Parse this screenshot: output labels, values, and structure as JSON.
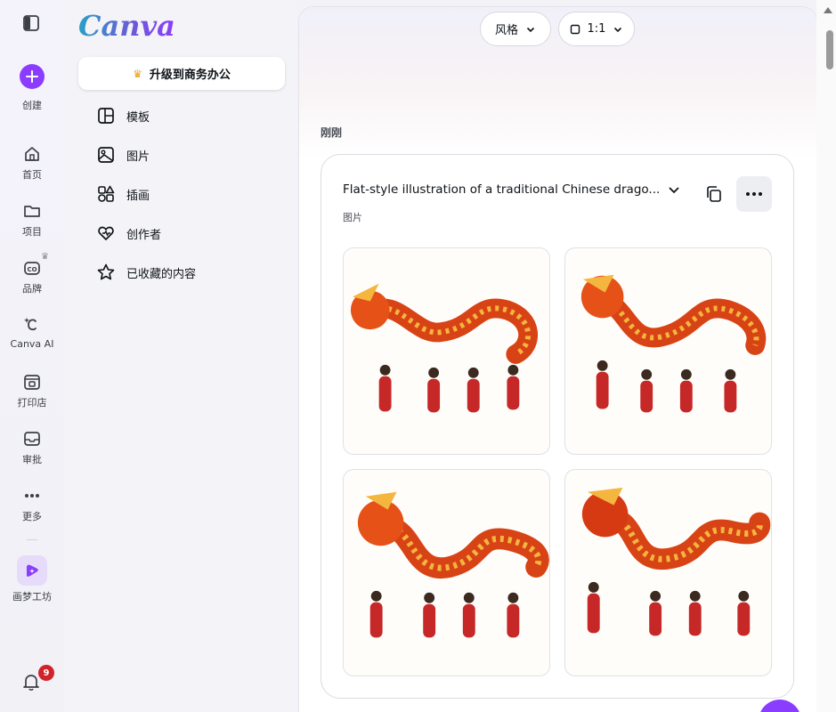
{
  "brand": {
    "logo_text": "Canva",
    "accent_color": "#8b3dff"
  },
  "rail": {
    "create_label": "创建",
    "items": [
      {
        "label": "首页",
        "icon": "home-icon"
      },
      {
        "label": "项目",
        "icon": "folder-icon"
      },
      {
        "label": "品牌",
        "icon": "brand-icon"
      },
      {
        "label": "Canva AI",
        "icon": "canva-ai-icon"
      },
      {
        "label": "打印店",
        "icon": "print-shop-icon"
      },
      {
        "label": "审批",
        "icon": "inbox-icon"
      },
      {
        "label": "更多",
        "icon": "more-dots-icon"
      },
      {
        "label": "画梦工坊",
        "icon": "dream-lab-icon"
      }
    ],
    "notification_count": "9"
  },
  "panel": {
    "upgrade_label": "升级到商务办公",
    "nav": [
      {
        "label": "模板",
        "icon": "template-icon"
      },
      {
        "label": "图片",
        "icon": "image-icon"
      },
      {
        "label": "插画",
        "icon": "shapes-icon"
      },
      {
        "label": "创作者",
        "icon": "heart-creator-icon"
      },
      {
        "label": "已收藏的内容",
        "icon": "star-icon"
      }
    ]
  },
  "main": {
    "style_pill": "风格",
    "ratio_pill": "1:1",
    "section_title": "刚刚",
    "result": {
      "prompt": "Flat-style illustration of a traditional Chinese drago...",
      "type_label": "图片",
      "images": [
        {
          "alt": "dragon-dance-1"
        },
        {
          "alt": "dragon-dance-2"
        },
        {
          "alt": "dragon-dance-3"
        },
        {
          "alt": "dragon-dance-4"
        }
      ]
    }
  }
}
